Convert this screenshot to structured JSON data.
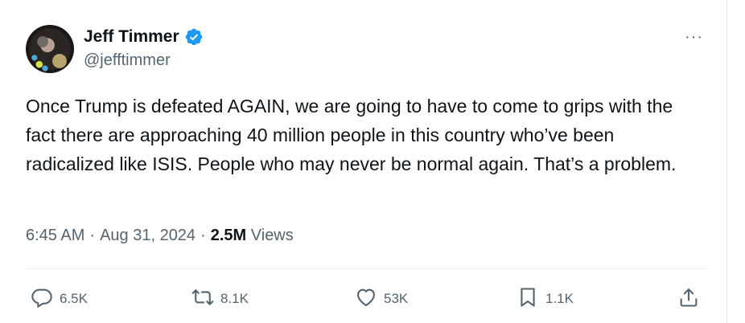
{
  "author": {
    "name": "Jeff Timmer",
    "handle": "@jefftimmer",
    "verified_icon": "verified-badge-icon",
    "badge_color": "#1d9bf0"
  },
  "tweet": {
    "text": "Once Trump is defeated AGAIN, we are going to have to come to grips with the fact there are approaching 40 million people in this country who’ve been radicalized like ISIS. People who may never be normal again. That’s a problem.",
    "time": "6:45 AM",
    "separator": "·",
    "date": "Aug 31, 2024",
    "views_count": "2.5M",
    "views_label": "Views"
  },
  "menu": {
    "more_label": "···"
  },
  "actions": {
    "reply": {
      "icon": "reply-icon",
      "count": "6.5K"
    },
    "retweet": {
      "icon": "retweet-icon",
      "count": "8.1K"
    },
    "like": {
      "icon": "heart-icon",
      "count": "53K"
    },
    "bookmark": {
      "icon": "bookmark-icon",
      "count": "1.1K"
    },
    "share": {
      "icon": "share-icon"
    }
  },
  "colors": {
    "text_primary": "#0f1419",
    "text_secondary": "#536471"
  }
}
